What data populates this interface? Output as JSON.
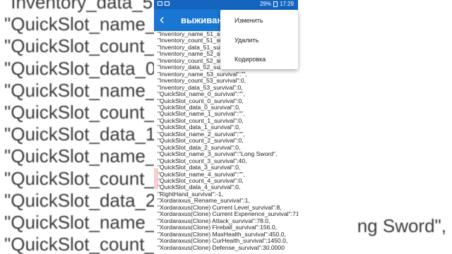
{
  "background": {
    "left_lines": [
      "\"Inventory_data_5",
      "\"QuickSlot_name_",
      "\"QuickSlot_count_",
      "\"QuickSlot_data_0",
      "\"QuickSlot_name_",
      "\"QuickSlot_count_",
      "\"QuickSlot_data_1",
      "\"QuickSlot_name_",
      "\"QuickSlot_count_",
      "\"QuickSlot_data_2",
      "\"QuickSlot_name_",
      "\"QuickSlot_count_"
    ],
    "right_lines": [
      "ng Sword\","
    ]
  },
  "statusbar": {
    "battery": "29%",
    "time": "17:29"
  },
  "appbar": {
    "back_icon": "‹",
    "title": "выживан"
  },
  "menu": {
    "items": [
      "Изменить",
      "Удалить",
      "Кодировка"
    ]
  },
  "content": {
    "lines": [
      "\"Inventory_name_51_survival\":\"\",",
      "\"Inventory_count_51_survival\":0,",
      "\"Inventory_data_51_survival\":0,",
      "\"Inventory_name_52_survival\":\"\",",
      "\"Inventory_count_52_survival\":0,",
      "\"Inventory_data_52_survival\":0,",
      "\"Inventory_name_53_survival\":\"\",",
      "\"Inventory_count_53_survival\":0,",
      "\"Inventory_data_53_survival\":0,",
      "\"QuickSlot_name_0_survival\":\"\",",
      "\"QuickSlot_count_0_survival\":0,",
      "\"QuickSlot_data_0_survival\":0,",
      "\"QuickSlot_name_1_survival\":\"\",",
      "\"QuickSlot_count_1_survival\":0,",
      "\"QuickSlot_data_1_survival\":0,",
      "\"QuickSlot_name_2_survival\":\"\",",
      "\"QuickSlot_count_2_survival\":0,",
      "\"QuickSlot_data_2_survival\":0,",
      "\"QuickSlot_name_3_survival\":\"Long Sword\",",
      "\"QuickSlot_count_3_survival\":40,",
      "\"QuickSlot_data_3_survival\":0,",
      "\"QuickSlot_name_4_survival\":\"\",",
      "\"QuickSlot_count_4_survival\":0,",
      "\"QuickSlot_data_4_survival\":0,",
      "\"RightHand_survival\":-1,",
      "\"Xordaraxus_Rename_survival\":1,",
      "\"Xordaraxus(Clone) Current Level_survival\":8,",
      "\"Xordaraxus(Clone) Current Experience_survival\":71,",
      "\"Xordaraxus(Clone) Attack_survival\":78.0,",
      "\"Xordaraxus(Clone) Fireball_survival\":156.0,",
      "\"Xordaraxus(Clone) MaxHealth_survival\":450.0,",
      "\"Xordaraxus(Clone) CurHealth_survival\":1450.0,",
      "\"Xordaraxus(Clone) Defense_survival\":30.0000"
    ]
  }
}
